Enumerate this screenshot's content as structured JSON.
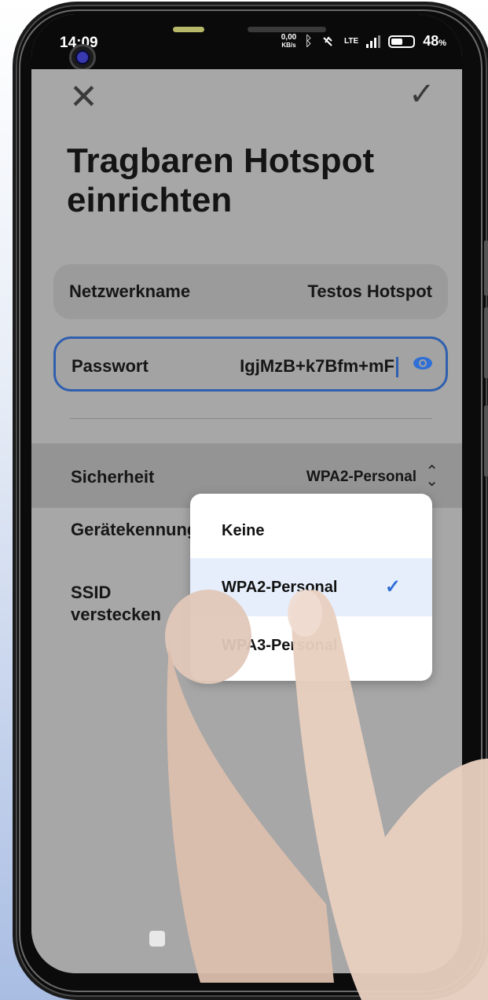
{
  "status_bar": {
    "time": "14:09",
    "net_speed_value": "0,00",
    "net_speed_unit": "KB/s",
    "network": "LTE",
    "battery": "48",
    "battery_unit": "%"
  },
  "header": {
    "title": "Tragbaren Hotspot einrichten"
  },
  "fields": {
    "network_name_label": "Netzwerkname",
    "network_name_value": "Testos Hotspot",
    "password_label": "Passwort",
    "password_value": "IgjMzB+k7Bfm+mF"
  },
  "security": {
    "label": "Sicherheit",
    "value": "WPA2-Personal"
  },
  "settings": {
    "device_id_label": "Gerätekennung",
    "hide_ssid_label": "SSID verstecken"
  },
  "dropdown": {
    "options": [
      "Keine",
      "WPA2-Personal",
      "WPA3-Personal"
    ],
    "selected": "WPA2-Personal"
  },
  "colors": {
    "accent": "#2f6fd6"
  }
}
